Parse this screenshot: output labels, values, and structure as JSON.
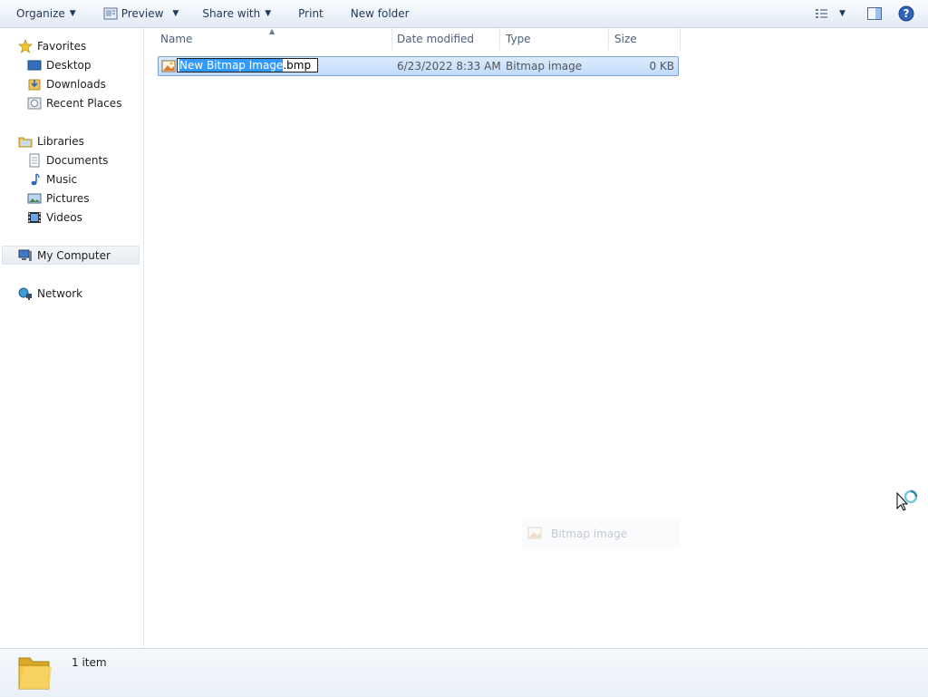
{
  "toolbar": {
    "organize": "Organize",
    "preview": "Preview",
    "share_with": "Share with",
    "print": "Print",
    "new_folder": "New folder"
  },
  "nav": {
    "favorites": "Favorites",
    "desktop": "Desktop",
    "downloads": "Downloads",
    "recent_places": "Recent Places",
    "libraries": "Libraries",
    "documents": "Documents",
    "music": "Music",
    "pictures": "Pictures",
    "videos": "Videos",
    "my_computer": "My Computer",
    "network": "Network"
  },
  "columns": {
    "name": "Name",
    "date_modified": "Date modified",
    "type": "Type",
    "size": "Size"
  },
  "files": [
    {
      "name_selected": "New Bitmap Image",
      "name_rest": ".bmp",
      "date_modified": "6/23/2022 8:33 AM",
      "type": "Bitmap image",
      "size": "0 KB"
    }
  ],
  "ghost_tooltip": "Bitmap image",
  "status": {
    "item_count": "1 item"
  },
  "colors": {
    "selection": "#3399ff",
    "row_highlight": "#c1dcfc",
    "toolbar_text": "#1e395b"
  }
}
